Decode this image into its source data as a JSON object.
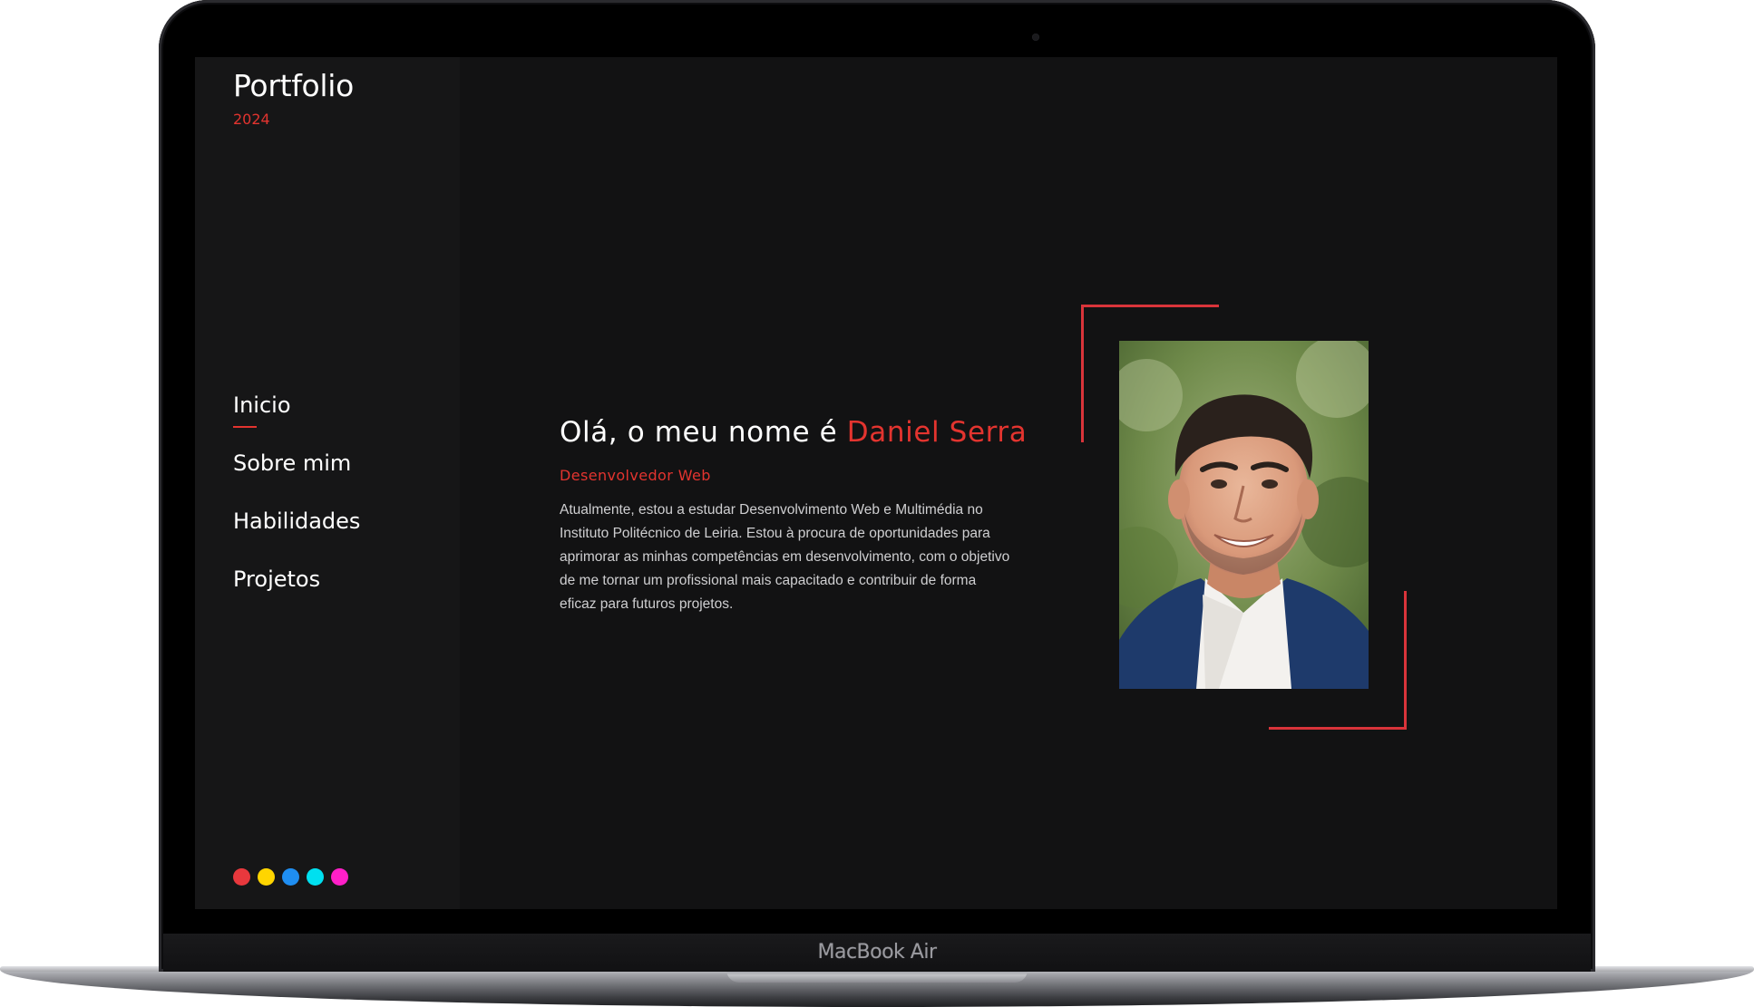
{
  "device": {
    "label": "MacBook Air"
  },
  "sidebar": {
    "title": "Portfolio",
    "year": "2024",
    "nav": [
      {
        "label": "Inicio",
        "active": true
      },
      {
        "label": "Sobre mim",
        "active": false
      },
      {
        "label": "Habilidades",
        "active": false
      },
      {
        "label": "Projetos",
        "active": false
      }
    ],
    "theme_colors": [
      "#e8383d",
      "#ffd500",
      "#1f8ef1",
      "#00e0f0",
      "#ff1fc8"
    ]
  },
  "hero": {
    "greeting": "Olá, o meu nome é",
    "name": "Daniel Serra",
    "role": "Desenvolvedor Web",
    "description": "Atualmente, estou a estudar Desenvolvimento Web e Multimédia no Instituto Politécnico de Leiria. Estou à procura de oportunidades para aprimorar as minhas competências em desenvolvimento, com o objetivo de me tornar um profissional mais capacitado e contribuir de forma eficaz para futuros projetos."
  },
  "colors": {
    "accent": "#e3342f",
    "background": "#121213",
    "sidebar_background": "#161617",
    "text": "#ffffff"
  }
}
